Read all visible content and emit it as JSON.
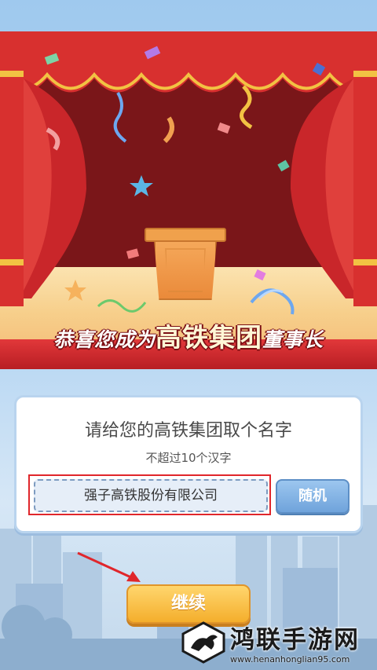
{
  "banner": {
    "prefix": "恭喜您成为",
    "company": "高铁集团",
    "suffix": "董事长"
  },
  "dialog": {
    "title": "请给您的高铁集团取个名字",
    "subtitle": "不超过10个汉字",
    "name_value": "强子高铁股份有限公司",
    "random_label": "随机"
  },
  "actions": {
    "continue_label": "继续"
  },
  "watermark": {
    "site_name": "鸿联手游网",
    "url": "www.henanhonglian95.com"
  },
  "colors": {
    "curtain_red": "#d8302f",
    "highlight_red": "#e0262b",
    "continue_button": "#f4ae2c",
    "random_button": "#6fa3db"
  }
}
